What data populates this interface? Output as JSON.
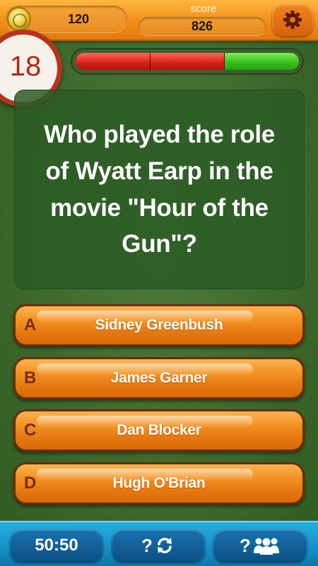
{
  "header": {
    "coins": "120",
    "score_label": "score",
    "score": "826"
  },
  "timer": {
    "seconds": "18"
  },
  "progress": {
    "segments": [
      {
        "state": "wrong",
        "color": "#d9231a"
      },
      {
        "state": "wrong",
        "color": "#d9231a"
      },
      {
        "state": "correct",
        "color": "#38c21e"
      }
    ]
  },
  "question": {
    "text": "Who played the role of Wyatt Earp in the movie \"Hour of the Gun\"?"
  },
  "answers": [
    {
      "letter": "A",
      "text": "Sidney Greenbush"
    },
    {
      "letter": "B",
      "text": "James Garner"
    },
    {
      "letter": "C",
      "text": "Dan Blocker"
    },
    {
      "letter": "D",
      "text": "Hugh O'Brian"
    }
  ],
  "lifelines": {
    "fifty_fifty": "50:50",
    "switch_glyph": "?",
    "audience_glyph": "?",
    "icons": [
      "refresh-arrows-icon",
      "people-group-icon"
    ]
  },
  "colors": {
    "header_orange": "#f08a14",
    "answer_orange": "#f39324",
    "bottom_blue": "#1590c8",
    "timer_red": "#b02817",
    "background_green": "#3d6a2c"
  }
}
